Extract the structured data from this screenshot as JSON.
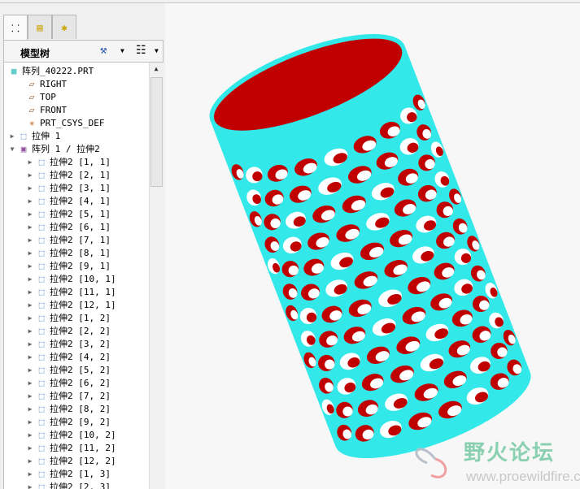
{
  "model_tree": {
    "title": "模型树",
    "root": "阵列_40222.PRT",
    "items": [
      {
        "label": "RIGHT",
        "icon": "datum-plane-icon",
        "expand": ""
      },
      {
        "label": "TOP",
        "icon": "datum-plane-icon",
        "expand": ""
      },
      {
        "label": "FRONT",
        "icon": "datum-plane-icon",
        "expand": ""
      },
      {
        "label": "PRT_CSYS_DEF",
        "icon": "csys-icon",
        "expand": ""
      },
      {
        "label": "拉伸 1",
        "icon": "extrude-icon",
        "expand": "collapsed"
      },
      {
        "label": "阵列 1 / 拉伸2",
        "icon": "pattern-icon",
        "expand": "expanded"
      }
    ],
    "pattern_members": [
      "拉伸2 [1, 1]",
      "拉伸2 [2, 1]",
      "拉伸2 [3, 1]",
      "拉伸2 [4, 1]",
      "拉伸2 [5, 1]",
      "拉伸2 [6, 1]",
      "拉伸2 [7, 1]",
      "拉伸2 [8, 1]",
      "拉伸2 [9, 1]",
      "拉伸2 [10, 1]",
      "拉伸2 [11, 1]",
      "拉伸2 [12, 1]",
      "拉伸2 [1, 2]",
      "拉伸2 [2, 2]",
      "拉伸2 [3, 2]",
      "拉伸2 [4, 2]",
      "拉伸2 [5, 2]",
      "拉伸2 [6, 2]",
      "拉伸2 [7, 2]",
      "拉伸2 [8, 2]",
      "拉伸2 [9, 2]",
      "拉伸2 [10, 2]",
      "拉伸2 [11, 2]",
      "拉伸2 [12, 2]",
      "拉伸2 [1, 3]",
      "拉伸2 [2, 3]"
    ]
  },
  "watermark": {
    "name": "野火论坛",
    "url": "www.proewildfire.cn"
  },
  "colors": {
    "body": "#33e8e8",
    "inner": "#c00000"
  }
}
